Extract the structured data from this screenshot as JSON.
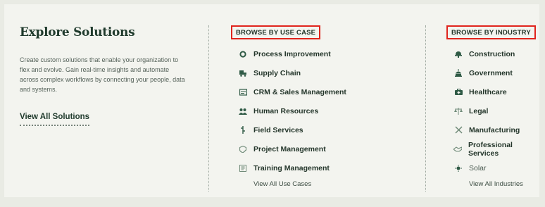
{
  "left": {
    "title": "Explore Solutions",
    "description": "Create custom solutions that enable your organization to flex and evolve. Gain real-time insights and automate across complex workflows by connecting your people, data and systems.",
    "view_all": "View All Solutions"
  },
  "use_case": {
    "heading": "BROWSE BY USE CASE",
    "items": [
      {
        "label": "Process Improvement",
        "icon": "process-icon"
      },
      {
        "label": "Supply Chain",
        "icon": "supply-chain-icon"
      },
      {
        "label": "CRM & Sales Management",
        "icon": "crm-icon"
      },
      {
        "label": "Human Resources",
        "icon": "people-icon"
      },
      {
        "label": "Field Services",
        "icon": "field-service-icon"
      },
      {
        "label": "Project Management",
        "icon": "project-icon"
      },
      {
        "label": "Training Management",
        "icon": "training-icon"
      }
    ],
    "view_all": "View All Use Cases"
  },
  "industry": {
    "heading": "BROWSE BY INDUSTRY",
    "items": [
      {
        "label": "Construction",
        "icon": "hardhat-icon"
      },
      {
        "label": "Government",
        "icon": "government-icon"
      },
      {
        "label": "Healthcare",
        "icon": "healthcare-icon"
      },
      {
        "label": "Legal",
        "icon": "scales-icon"
      },
      {
        "label": "Manufacturing",
        "icon": "tools-icon"
      },
      {
        "label": "Professional Services",
        "icon": "handshake-icon"
      },
      {
        "label": "Solar",
        "icon": "sun-icon"
      }
    ],
    "view_all": "View All Industries"
  },
  "colors": {
    "accent": "#2f5a45",
    "highlight_border": "#e0241d"
  }
}
